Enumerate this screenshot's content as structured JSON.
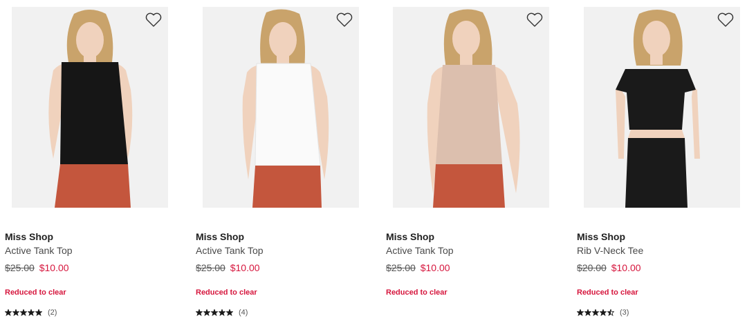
{
  "products": [
    {
      "brand": "Miss Shop",
      "name": "Active Tank Top",
      "was_price": "$25.00",
      "now_price": "$10.00",
      "promo": "Reduced to clear",
      "rating_stars": 5,
      "review_count": "(2)",
      "garment": "black sleeveless tank top",
      "colors": {
        "top": "#161616",
        "bottom": "#c4563d",
        "hair": "#c9a36b"
      }
    },
    {
      "brand": "Miss Shop",
      "name": "Active Tank Top",
      "was_price": "$25.00",
      "now_price": "$10.00",
      "promo": "Reduced to clear",
      "rating_stars": 5,
      "review_count": "(4)",
      "garment": "white sleeveless tank top",
      "colors": {
        "top": "#fafafa",
        "bottom": "#c4563d",
        "hair": "#c9a36b"
      }
    },
    {
      "brand": "Miss Shop",
      "name": "Active Tank Top",
      "was_price": "$25.00",
      "now_price": "$10.00",
      "promo": "Reduced to clear",
      "rating_stars": null,
      "review_count": null,
      "garment": "beige sleeveless tank top",
      "colors": {
        "top": "#dcbfae",
        "bottom": "#c4563d",
        "hair": "#c9a36b"
      }
    },
    {
      "brand": "Miss Shop",
      "name": "Rib V-Neck Tee",
      "was_price": "$20.00",
      "now_price": "$10.00",
      "promo": "Reduced to clear",
      "rating_stars": 4.5,
      "review_count": "(3)",
      "garment": "black short-sleeve v-neck tee",
      "colors": {
        "top": "#1a1a1a",
        "bottom": "#1a1a1a",
        "hair": "#c9a36b"
      }
    }
  ],
  "icons": {
    "wishlist": "heart-outline-icon",
    "rating": "star-icon"
  },
  "theme": {
    "sale_red": "#d6163d",
    "text_dark": "#1f1f1f",
    "image_bg": "#f1f1f1"
  }
}
